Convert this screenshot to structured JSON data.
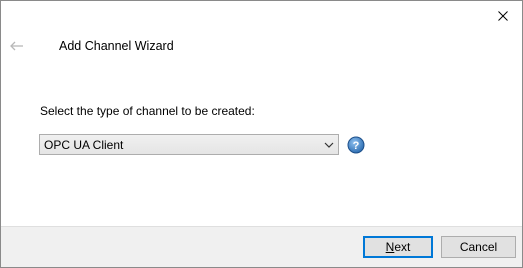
{
  "dialog": {
    "title": "Add Channel Wizard"
  },
  "icons": {
    "back": "back-arrow-icon",
    "close": "close-icon",
    "combo_arrow": "chevron-down-icon",
    "help": "help-icon"
  },
  "form": {
    "prompt": "Select the type of channel to be created:",
    "channel_type": {
      "selected": "OPC UA Client"
    }
  },
  "footer": {
    "next_label_accel": "N",
    "next_label_rest": "ext",
    "cancel_label": "Cancel"
  },
  "colors": {
    "accent": "#0078d7",
    "footer_bg": "#f0f0f0",
    "help_icon": "#2f6fb3"
  }
}
